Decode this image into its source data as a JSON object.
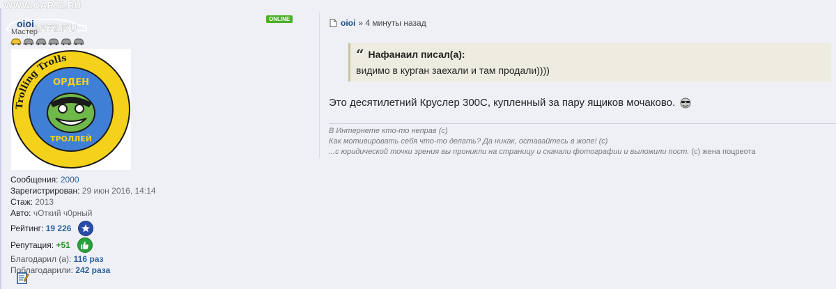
{
  "watermark": {
    "site": "WWW.CAR72.RU",
    "logo": "CAR72.RU"
  },
  "user": {
    "username": "oioi",
    "rank": "Мастер",
    "online_badge": "ONLINE",
    "stats": {
      "messages_label": "Сообщения:",
      "messages_value": "2000",
      "registered_label": "Зарегистрирован:",
      "registered_value": "29 июн 2016, 14:14",
      "experience_label": "Стаж:",
      "experience_value": "2013",
      "car_label": "Авто:",
      "car_value": "чОткий ч0рный",
      "rating_label": "Рейтинг:",
      "rating_value": "19 226",
      "reputation_label": "Репутация:",
      "reputation_value": "+51",
      "thanked_label": "Благодарил (а):",
      "thanked_value": "116 раз",
      "was_thanked_label": "Поблагодарили:",
      "was_thanked_value": "242 раза"
    },
    "avatar_text": {
      "ring_text": "Trolling Trolls",
      "top": "ОРДЕН",
      "bottom": "ТРОЛЛЕЙ"
    }
  },
  "post": {
    "author": "oioi",
    "time": "» 4 минуты назад",
    "quote_author": "Нафанаил писал(а):",
    "quote_text": "видимо в курган заехали и там продали))))",
    "body": "Это десятилетний Круслер 300С, купленный за пару ящиков мочаково.",
    "signature": [
      "В Интернете кто-то неправ (с)",
      "Как мотивировать себя что-то делать? Да никак, оставайтесь в жопе! (с)",
      "...с юридической точки зрения вы проникли на страницу и скачали фотографии и выложили пост.",
      "(с) жена поцреота"
    ]
  },
  "colors": {
    "link": "#1b4b8a",
    "value": "#2a5f9e",
    "online": "#4caf2b",
    "rating_badge": "#2a4ea8",
    "reputation_badge": "#2aa13a",
    "quote_bg": "#eeece0"
  },
  "icons": {
    "rating": "star-icon",
    "reputation": "thumbs-up-icon",
    "post": "document-icon",
    "edit": "edit-note-icon",
    "smiley": "sunglasses-smiley-icon"
  }
}
